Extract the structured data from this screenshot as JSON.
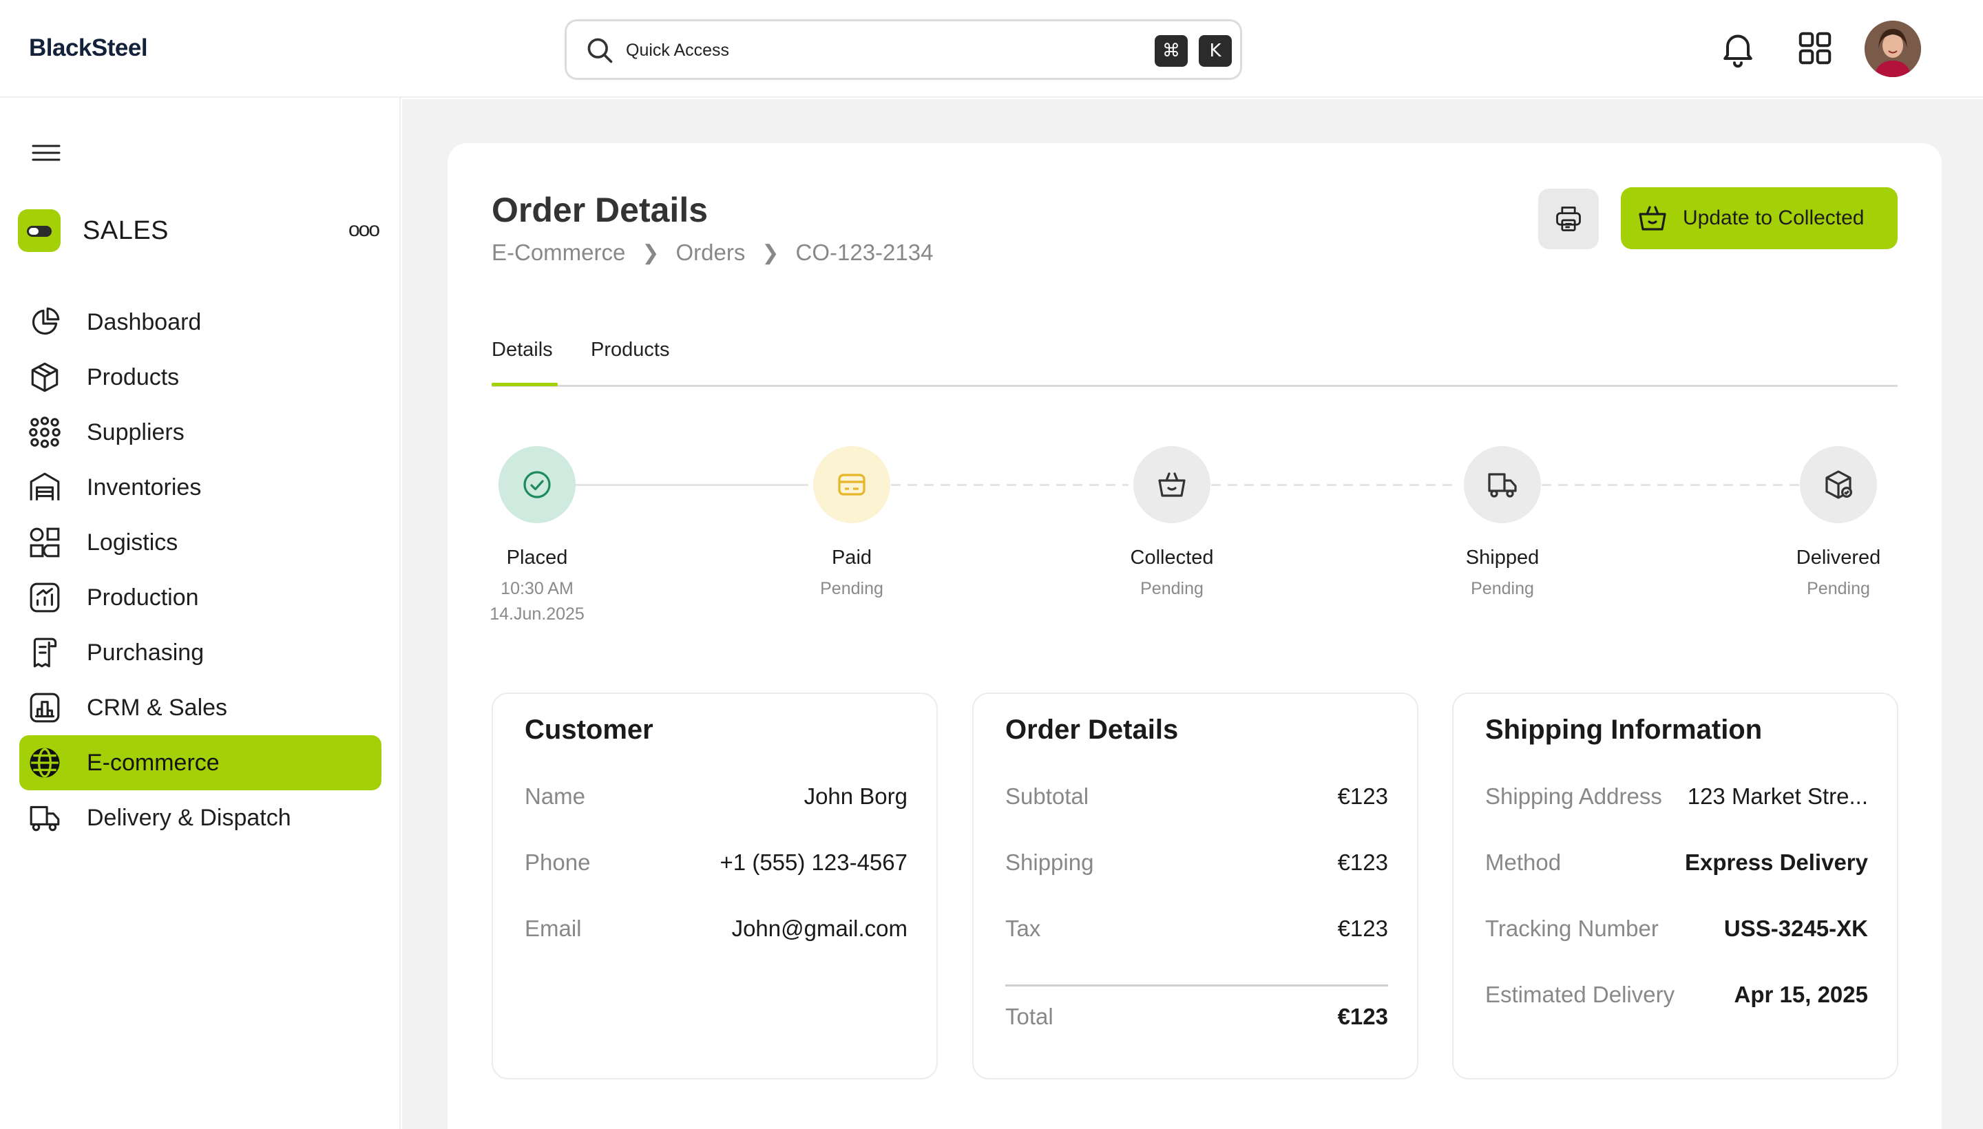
{
  "app": {
    "logo": "BlackSteel"
  },
  "search": {
    "placeholder": "Quick Access",
    "shortcut": [
      "⌘",
      "K"
    ]
  },
  "sidebar": {
    "module_title": "SALES",
    "more": "ooo",
    "items": [
      {
        "label": "Dashboard",
        "icon": "pie-chart-icon",
        "active": false
      },
      {
        "label": "Products",
        "icon": "box-icon",
        "active": false
      },
      {
        "label": "Suppliers",
        "icon": "network-icon",
        "active": false
      },
      {
        "label": "Inventories",
        "icon": "warehouse-icon",
        "active": false
      },
      {
        "label": "Logistics",
        "icon": "shapes-icon",
        "active": false
      },
      {
        "label": "Production",
        "icon": "chart-up-icon",
        "active": false
      },
      {
        "label": "Purchasing",
        "icon": "receipt-icon",
        "active": false
      },
      {
        "label": "CRM & Sales",
        "icon": "bar-chart-icon",
        "active": false
      },
      {
        "label": "E-commerce",
        "icon": "globe-icon",
        "active": true
      },
      {
        "label": "Delivery & Dispatch",
        "icon": "truck-icon",
        "active": false
      }
    ]
  },
  "page": {
    "title": "Order Details",
    "breadcrumb": [
      "E-Commerce",
      "Orders",
      "CO-123-2134"
    ],
    "primary_action": "Update to Collected",
    "tabs": [
      "Details",
      "Products"
    ],
    "active_tab": "Details"
  },
  "steps": [
    {
      "name": "Placed",
      "sub1": "10:30 AM",
      "sub2": "14.Jun.2025",
      "icon": "check-circle-icon",
      "bg": "#cfeadf",
      "fg": "#1f8a5b"
    },
    {
      "name": "Paid",
      "sub1": "Pending",
      "sub2": "",
      "icon": "credit-card-icon",
      "bg": "#fcf3d2",
      "fg": "#e5b52a"
    },
    {
      "name": "Collected",
      "sub1": "Pending",
      "sub2": "",
      "icon": "basket-icon",
      "bg": "#ebebeb",
      "fg": "#333333"
    },
    {
      "name": "Shipped",
      "sub1": "Pending",
      "sub2": "",
      "icon": "truck-icon",
      "bg": "#ebebeb",
      "fg": "#333333"
    },
    {
      "name": "Delivered",
      "sub1": "Pending",
      "sub2": "",
      "icon": "package-check-icon",
      "bg": "#ebebeb",
      "fg": "#333333"
    }
  ],
  "customer": {
    "title": "Customer",
    "rows": [
      {
        "label": "Name",
        "value": "John Borg"
      },
      {
        "label": "Phone",
        "value": "+1 (555) 123-4567"
      },
      {
        "label": "Email",
        "value": "John@gmail.com"
      }
    ]
  },
  "order": {
    "title": "Order Details",
    "rows": [
      {
        "label": "Subtotal",
        "value": "€123"
      },
      {
        "label": "Shipping",
        "value": "€123"
      },
      {
        "label": "Tax",
        "value": "€123"
      }
    ],
    "total": {
      "label": "Total",
      "value": "€123"
    }
  },
  "shipping": {
    "title": "Shipping Information",
    "rows": [
      {
        "label": "Shipping Address",
        "value": "123 Market Stre..."
      },
      {
        "label": "Method",
        "value": "Express Delivery"
      },
      {
        "label": "Tracking Number",
        "value": "USS-3245-XK"
      },
      {
        "label": "Estimated Delivery",
        "value": "Apr 15, 2025"
      }
    ]
  },
  "colors": {
    "accent": "#a4d007",
    "placed": "#1f8a5b",
    "paid": "#e5b52a"
  }
}
